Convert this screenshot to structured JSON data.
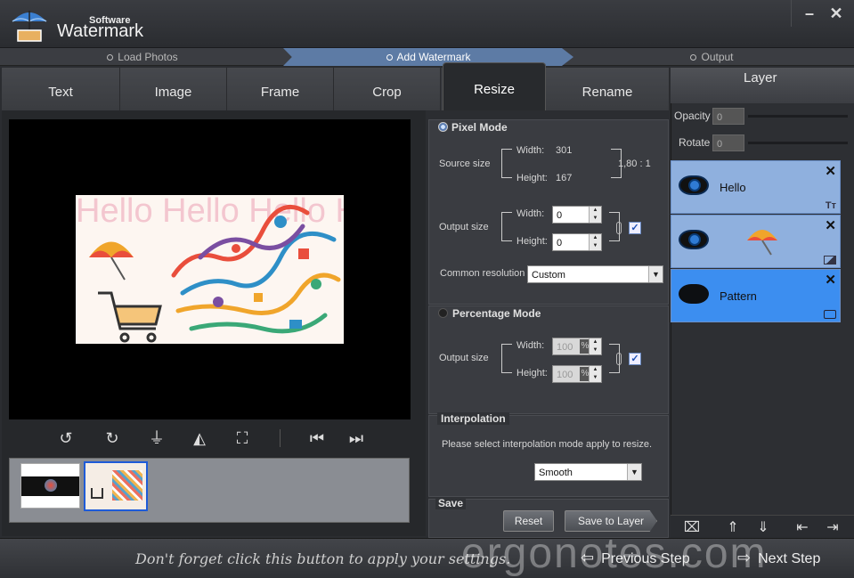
{
  "app": {
    "title_small": "Software",
    "title_big": "Watermark"
  },
  "window_controls": {
    "minimize": "–",
    "close": "✕"
  },
  "steps": [
    {
      "label": "Load Photos"
    },
    {
      "label": "Add Watermark"
    },
    {
      "label": "Output"
    }
  ],
  "tabs": [
    "Text",
    "Image",
    "Frame",
    "Crop",
    "Resize",
    "Rename"
  ],
  "active_tab": "Resize",
  "preview": {
    "watermark_text": "Hello Hello Hello Hello"
  },
  "pixel_mode": {
    "title": "Pixel Mode",
    "source_label": "Source size",
    "source_width_label": "Width:",
    "source_width": "301",
    "source_height_label": "Height:",
    "source_height": "167",
    "ratio": "1,80 : 1",
    "output_label": "Output size",
    "out_width_label": "Width:",
    "out_width": "0",
    "out_height_label": "Height:",
    "out_height": "0",
    "common_label": "Common resolution",
    "common_value": "Custom"
  },
  "percentage_mode": {
    "title": "Percentage Mode",
    "output_label": "Output size",
    "width_label": "Width:",
    "width": "100",
    "height_label": "Height:",
    "height": "100",
    "unit": "%"
  },
  "interpolation": {
    "title": "Interpolation",
    "description": "Please select interpolation mode apply to resize.",
    "value": "Smooth"
  },
  "save": {
    "title": "Save",
    "reset": "Reset",
    "save_to_layer": "Save to Layer"
  },
  "layer_panel": {
    "title": "Layer",
    "opacity_label": "Opacity",
    "opacity_value": "0",
    "rotate_label": "Rotate",
    "rotate_value": "0",
    "layers": [
      {
        "name": "Hello",
        "type_icon": "text-type-icon"
      },
      {
        "name": "",
        "type_icon": "image-type-icon"
      },
      {
        "name": "Pattern",
        "type_icon": "frame-type-icon"
      }
    ]
  },
  "bottom": {
    "hint": "Don't forget click this button to apply your settings.",
    "watermark": "ergonotes.com",
    "previous": "Previous Step",
    "next": "Next Step"
  },
  "colors": {
    "accent": "#5d7ba5",
    "layer_bg": "#8fb0de",
    "layer_selected": "#3c8ef0"
  }
}
